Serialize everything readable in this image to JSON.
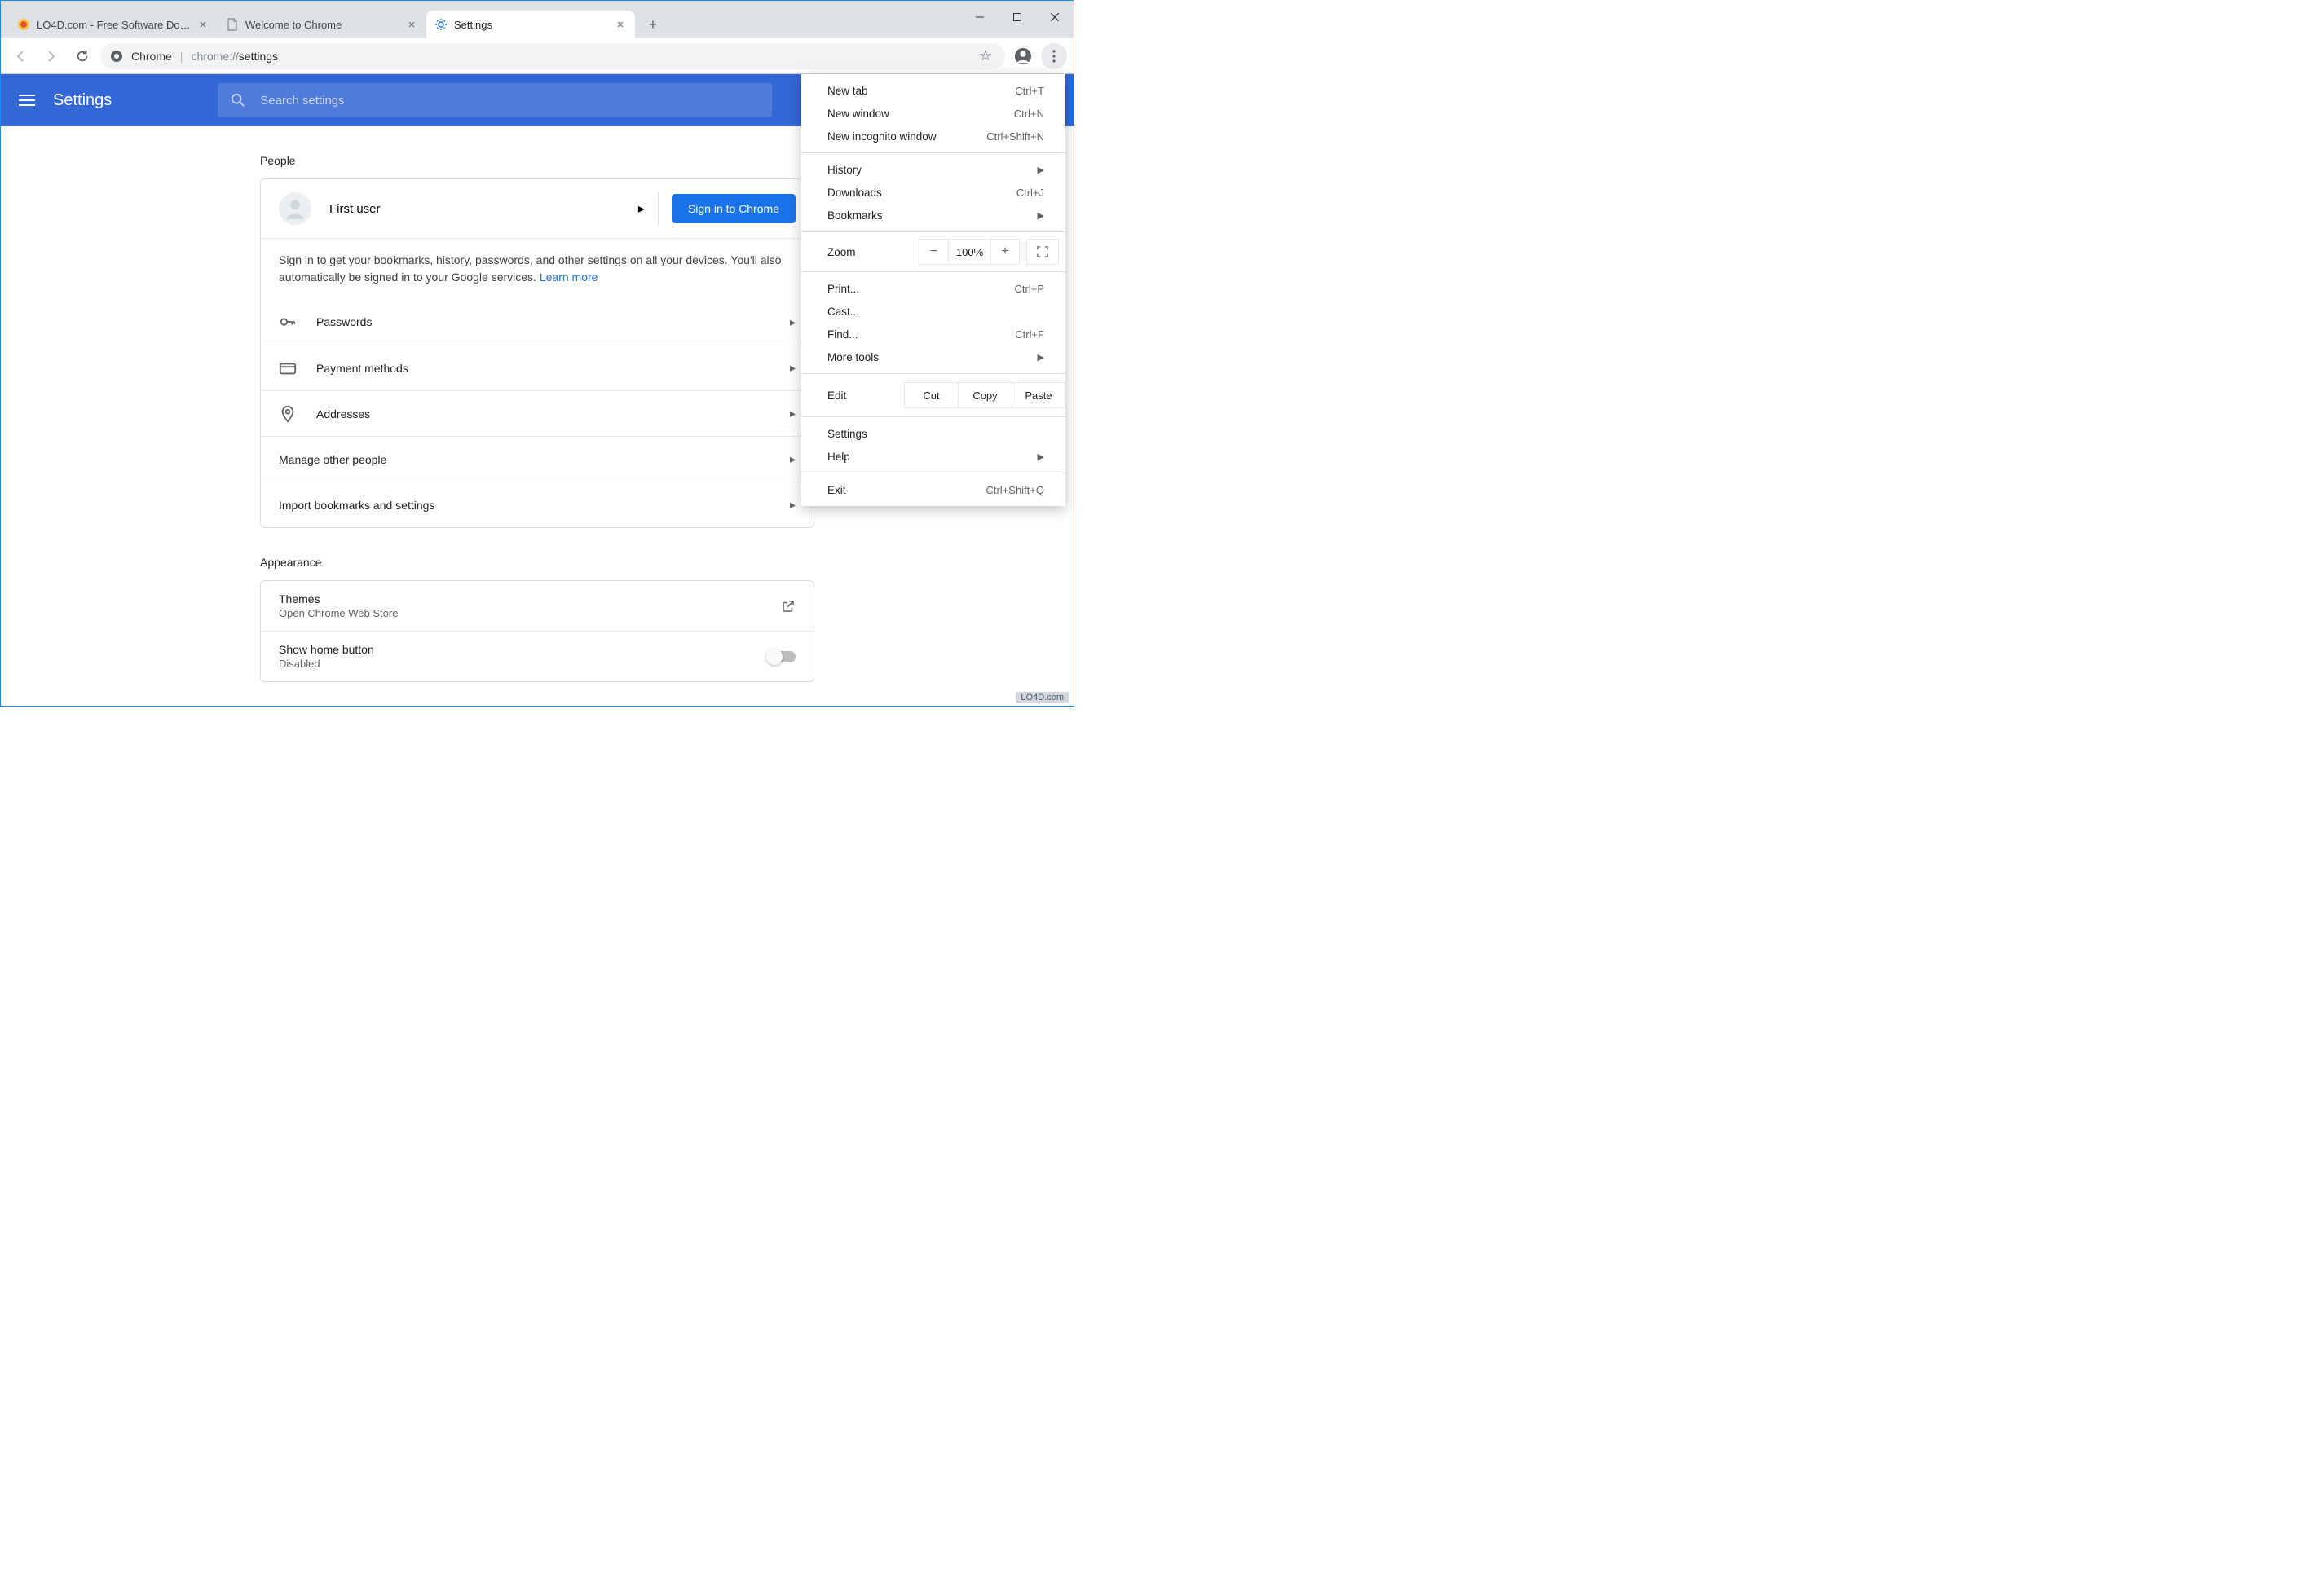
{
  "tabs": [
    {
      "title": "LO4D.com - Free Software Downloads",
      "active": false
    },
    {
      "title": "Welcome to Chrome",
      "active": false
    },
    {
      "title": "Settings",
      "active": true
    }
  ],
  "omnibox": {
    "product": "Chrome",
    "prefix": "chrome://",
    "path": "settings"
  },
  "settingsHeader": {
    "title": "Settings",
    "searchPlaceholder": "Search settings"
  },
  "sections": {
    "people": {
      "title": "People",
      "userName": "First user",
      "signInButton": "Sign in to Chrome",
      "description": "Sign in to get your bookmarks, history, passwords, and other settings on all your devices. You'll also automatically be signed in to your Google services. ",
      "learnMore": "Learn more",
      "rows": {
        "passwords": "Passwords",
        "payment": "Payment methods",
        "addresses": "Addresses",
        "manage": "Manage other people",
        "import": "Import bookmarks and settings"
      }
    },
    "appearance": {
      "title": "Appearance",
      "themes": "Themes",
      "themesSub": "Open Chrome Web Store",
      "homeBtn": "Show home button",
      "homeBtnSub": "Disabled"
    }
  },
  "menu": {
    "newTab": {
      "label": "New tab",
      "shortcut": "Ctrl+T"
    },
    "newWindow": {
      "label": "New window",
      "shortcut": "Ctrl+N"
    },
    "newIncognito": {
      "label": "New incognito window",
      "shortcut": "Ctrl+Shift+N"
    },
    "history": {
      "label": "History"
    },
    "downloads": {
      "label": "Downloads",
      "shortcut": "Ctrl+J"
    },
    "bookmarks": {
      "label": "Bookmarks"
    },
    "zoom": {
      "label": "Zoom",
      "value": "100%"
    },
    "print": {
      "label": "Print...",
      "shortcut": "Ctrl+P"
    },
    "cast": {
      "label": "Cast..."
    },
    "find": {
      "label": "Find...",
      "shortcut": "Ctrl+F"
    },
    "moreTools": {
      "label": "More tools"
    },
    "edit": {
      "label": "Edit",
      "cut": "Cut",
      "copy": "Copy",
      "paste": "Paste"
    },
    "settings": {
      "label": "Settings"
    },
    "help": {
      "label": "Help"
    },
    "exit": {
      "label": "Exit",
      "shortcut": "Ctrl+Shift+Q"
    }
  },
  "watermark": "LO4D.com"
}
